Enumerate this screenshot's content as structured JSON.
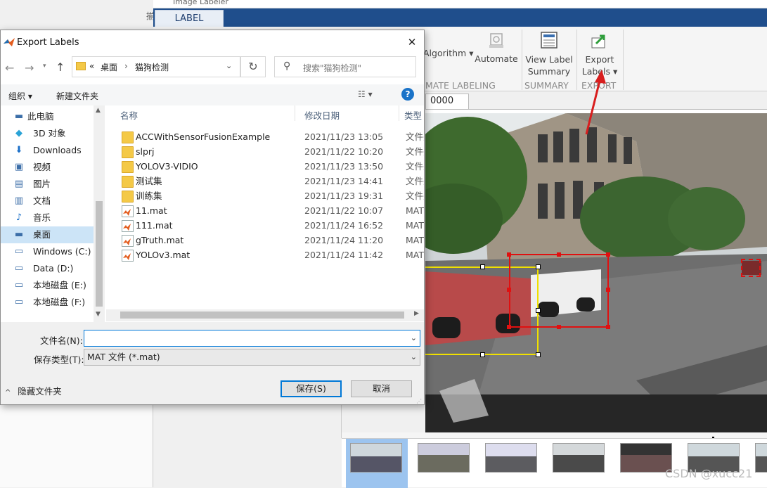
{
  "app": {
    "title_fragment": "Image Labeler",
    "left_fragment": "揃",
    "tab_label": "LABEL",
    "ribbon": {
      "algorithm_label": "Algorithm",
      "automate_label": "Automate",
      "view_label_summary": "View Label Summary",
      "export_labels": "Export Labels",
      "section_automate": "MATE LABELING",
      "section_summary": "SUMMARY",
      "section_export": "EXPORT"
    },
    "image_tab": "0000",
    "annotation_colors": {
      "arrow": "#d81e1e",
      "box_red": "#e01010",
      "box_yellow": "#f0e000"
    },
    "watermark": "CSDN @xucc21"
  },
  "dialog": {
    "title": "Export Labels",
    "close_glyph": "✕",
    "address": {
      "prefix": "«",
      "part1": "桌面",
      "separator": "›",
      "part2": "猫狗检测"
    },
    "search_placeholder": "搜索\"猫狗检测\"",
    "toolbar": {
      "organize": "组织 ▾",
      "new_folder": "新建文件夹",
      "view_glyph": "☷ ▾",
      "help_glyph": "?"
    },
    "tree": [
      {
        "label": "此电脑",
        "icon": "pc-icon",
        "glyph": "▬"
      },
      {
        "label": "3D 对象",
        "icon": "cube-icon",
        "glyph": "◆"
      },
      {
        "label": "Downloads",
        "icon": "download-icon",
        "glyph": "⬇"
      },
      {
        "label": "视频",
        "icon": "video-icon",
        "glyph": "▣"
      },
      {
        "label": "图片",
        "icon": "picture-icon",
        "glyph": "▤"
      },
      {
        "label": "文档",
        "icon": "document-icon",
        "glyph": "▥"
      },
      {
        "label": "音乐",
        "icon": "music-icon",
        "glyph": "♪"
      },
      {
        "label": "桌面",
        "icon": "desktop-icon",
        "glyph": "▬"
      },
      {
        "label": "Windows (C:)",
        "icon": "drive-icon",
        "glyph": "▭"
      },
      {
        "label": "Data (D:)",
        "icon": "drive-icon",
        "glyph": "▭"
      },
      {
        "label": "本地磁盘 (E:)",
        "icon": "drive-icon",
        "glyph": "▭"
      },
      {
        "label": "本地磁盘 (F:)",
        "icon": "drive-icon",
        "glyph": "▭"
      }
    ],
    "selected_tree_index": 7,
    "columns": {
      "name": "名称",
      "modified": "修改日期",
      "type": "类型"
    },
    "files": [
      {
        "name": "ACCWithSensorFusionExample",
        "date": "2021/11/23 13:05",
        "type": "文件夹",
        "kind": "folder"
      },
      {
        "name": "slprj",
        "date": "2021/11/22 10:20",
        "type": "文件夹",
        "kind": "folder"
      },
      {
        "name": "YOLOV3-VIDIO",
        "date": "2021/11/23 13:50",
        "type": "文件夹",
        "kind": "folder"
      },
      {
        "name": "测试集",
        "date": "2021/11/23 14:41",
        "type": "文件夹",
        "kind": "folder"
      },
      {
        "name": "训练集",
        "date": "2021/11/23 19:31",
        "type": "文件夹",
        "kind": "folder"
      },
      {
        "name": "11.mat",
        "date": "2021/11/22 10:07",
        "type": "MAT",
        "kind": "mat"
      },
      {
        "name": "111.mat",
        "date": "2021/11/24 16:52",
        "type": "MAT",
        "kind": "mat"
      },
      {
        "name": "gTruth.mat",
        "date": "2021/11/24 11:20",
        "type": "MAT",
        "kind": "mat"
      },
      {
        "name": "YOLOv3.mat",
        "date": "2021/11/24 11:42",
        "type": "MAT",
        "kind": "mat"
      }
    ],
    "filename_label": "文件名(N):",
    "filename_value": "",
    "savetype_label": "保存类型(T):",
    "savetype_value": "MAT 文件 (*.mat)",
    "hide_folders": "隐藏文件夹",
    "save_button": "保存(S)",
    "cancel_button": "取消"
  }
}
